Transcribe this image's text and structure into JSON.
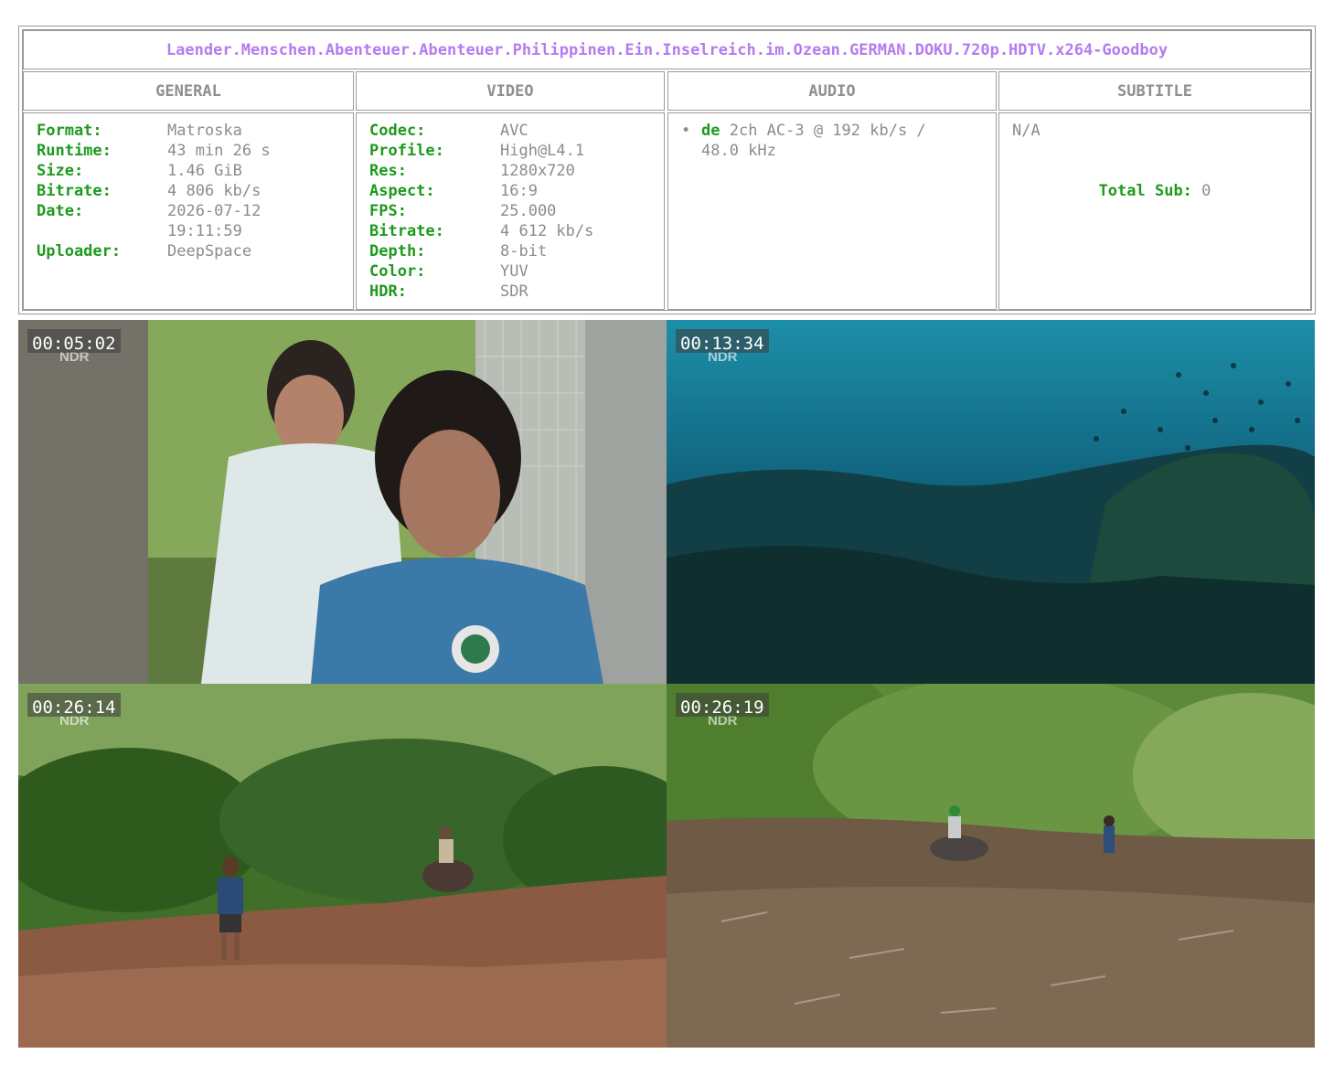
{
  "release_title": "Laender.Menschen.Abenteuer.Abenteuer.Philippinen.Ein.Inselreich.im.Ozean.GERMAN.DOKU.720p.HDTV.x264-Goodboy",
  "headers": {
    "general": "GENERAL",
    "video": "VIDEO",
    "audio": "AUDIO",
    "subtitle": "SUBTITLE"
  },
  "general": [
    {
      "key": "Format:",
      "value": "Matroska"
    },
    {
      "key": "Runtime:",
      "value": "43 min 26 s"
    },
    {
      "key": "Size:",
      "value": "1.46 GiB"
    },
    {
      "key": "Bitrate:",
      "value": "4 806 kb/s"
    },
    {
      "key": "Date:",
      "value": "2026-07-12\n19:11:59"
    },
    {
      "key": "Uploader:",
      "value": "DeepSpace"
    }
  ],
  "video": [
    {
      "key": "Codec:",
      "value": "AVC"
    },
    {
      "key": "Profile:",
      "value": "High@L4.1"
    },
    {
      "key": "Res:",
      "value": "1280x720"
    },
    {
      "key": "Aspect:",
      "value": "16:9"
    },
    {
      "key": "FPS:",
      "value": "25.000"
    },
    {
      "key": "Bitrate:",
      "value": "4 612 kb/s"
    },
    {
      "key": "Depth:",
      "value": "8-bit"
    },
    {
      "key": "Color:",
      "value": "YUV"
    },
    {
      "key": "HDR:",
      "value": "SDR"
    }
  ],
  "audio": {
    "bullet": "•",
    "lang": "de",
    "detail_line1": " 2ch AC-3 @ 192 kb/s /",
    "detail_line2": "48.0 kHz"
  },
  "subtitle": {
    "value": "N/A",
    "total_label": "Total Sub:",
    "total_value": "0"
  },
  "screenshots": [
    {
      "timestamp": "00:05:02",
      "logo": "NDR",
      "scene": "two-men-greenhouse"
    },
    {
      "timestamp": "00:13:34",
      "logo": "NDR",
      "scene": "coral-reef-underwater"
    },
    {
      "timestamp": "00:26:14",
      "logo": "NDR",
      "scene": "man-walking-field-buffalo"
    },
    {
      "timestamp": "00:26:19",
      "logo": "NDR",
      "scene": "buffalo-rider-cleared-field"
    }
  ],
  "colors": {
    "title": "#b57bf0",
    "key": "#1e9a1e",
    "value": "#8c8c8c",
    "border": "#9a9a9a"
  }
}
